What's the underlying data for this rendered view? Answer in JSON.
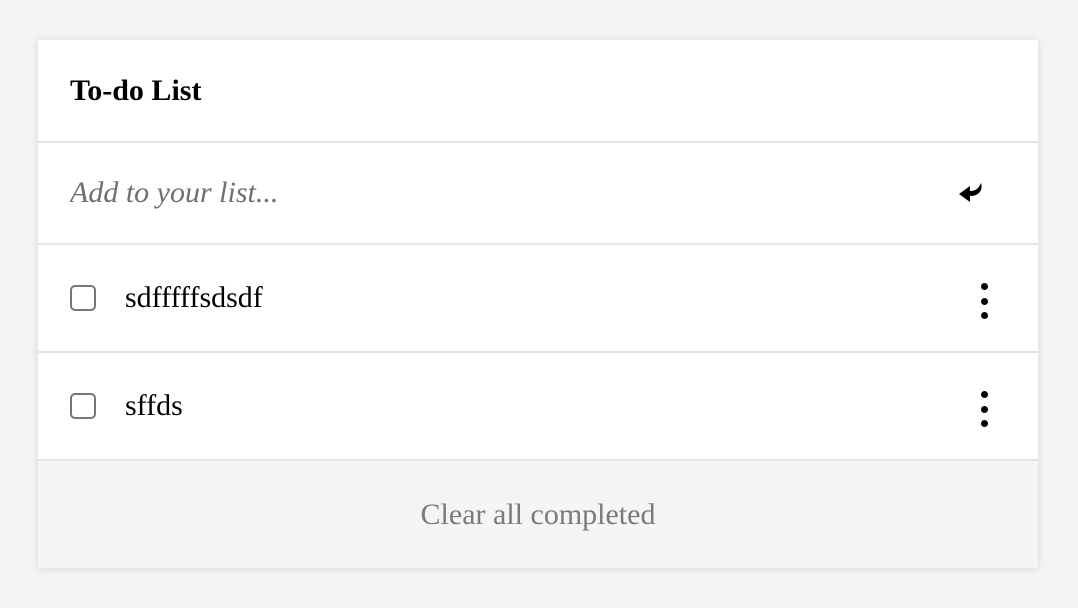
{
  "header": {
    "title": "To-do List"
  },
  "add_item": {
    "placeholder": "Add to your list...",
    "value": "",
    "submit_icon": "enter-arrow-icon"
  },
  "items": [
    {
      "label": "sdfffffsdsdf",
      "checked": false,
      "menu_icon": "kebab-menu-icon"
    },
    {
      "label": "sffds",
      "checked": false,
      "menu_icon": "kebab-menu-icon"
    }
  ],
  "footer": {
    "clear_label": "Clear all completed"
  }
}
